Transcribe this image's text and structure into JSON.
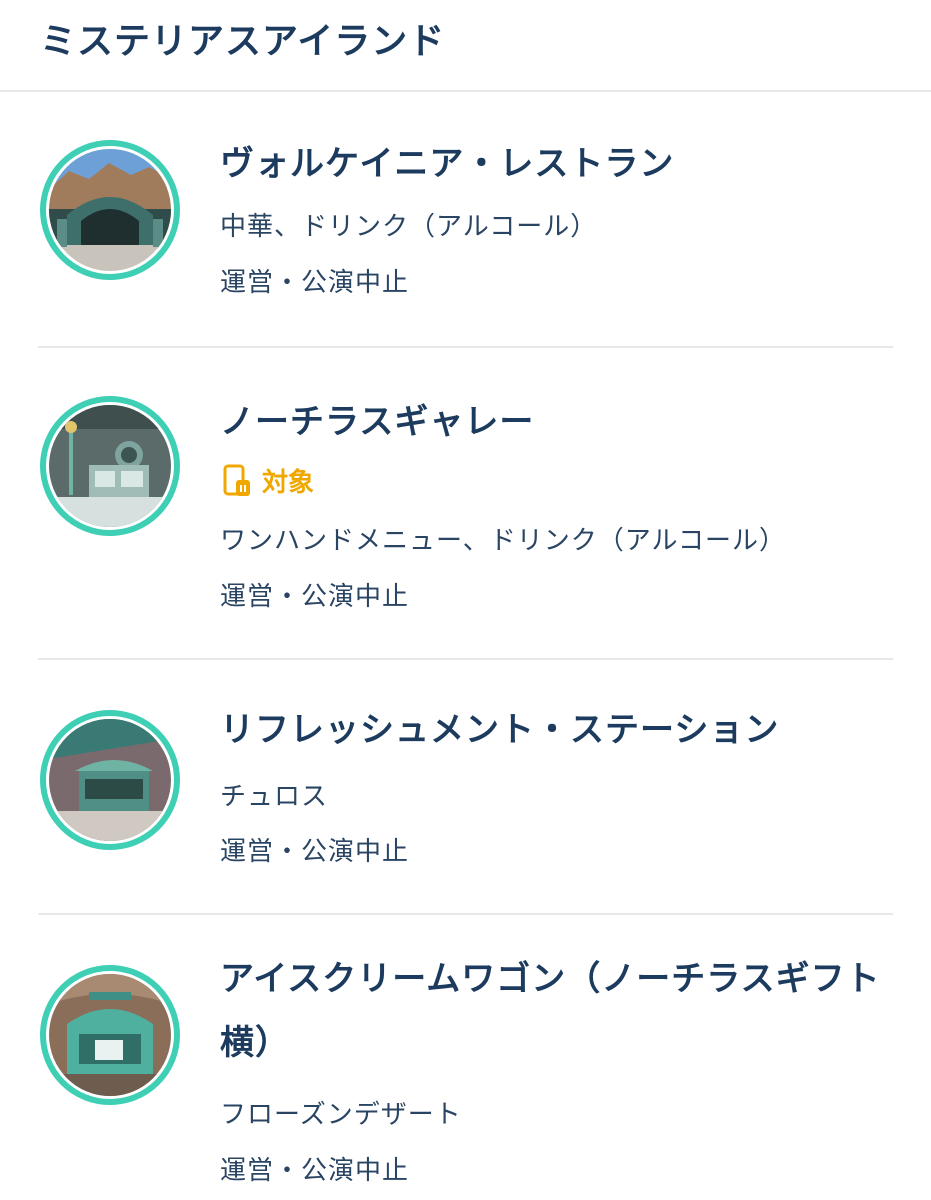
{
  "area": {
    "title": "ミステリアスアイランド"
  },
  "restaurants": [
    {
      "name": "ヴォルケイニア・レストラン",
      "cuisine": "中華、ドリンク（アルコール）",
      "status": "運営・公演中止"
    },
    {
      "name": "ノーチラスギャレー",
      "tag": "対象",
      "tag_icon": "mobile-order-icon",
      "cuisine": "ワンハンドメニュー、ドリンク（アルコール）",
      "status": "運営・公演中止"
    },
    {
      "name": "リフレッシュメント・ステーション",
      "cuisine": "チュロス",
      "status": "運営・公演中止"
    },
    {
      "name": "アイスクリームワゴン（ノーチラスギフト横）",
      "cuisine": "フローズンデザート",
      "status": "運営・公演中止"
    }
  ],
  "colors": {
    "title": "#1c3b5e",
    "ring": "#3ecfb5",
    "tag": "#f0a800",
    "divider": "#e6e9ec"
  }
}
